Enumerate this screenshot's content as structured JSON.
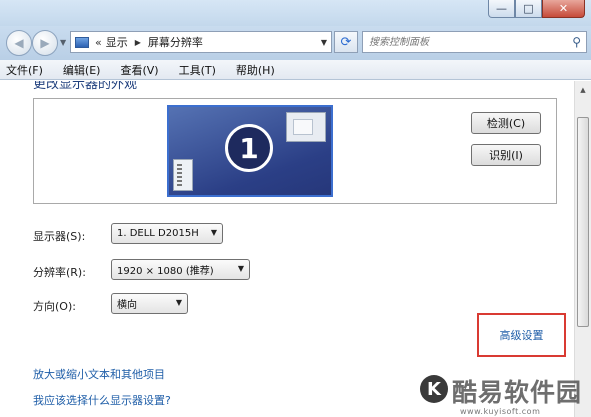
{
  "window": {
    "controls": {
      "minimize": "—",
      "maximize": "□",
      "close": "✕"
    }
  },
  "nav": {
    "back_icon": "back-arrow-icon",
    "forward_icon": "forward-arrow-icon",
    "address": {
      "chevron": "«",
      "breadcrumbs": [
        "显示",
        "屏幕分辨率"
      ]
    },
    "refresh_icon": "refresh-icon",
    "search": {
      "placeholder": "搜索控制面板",
      "icon": "search-icon"
    }
  },
  "menu": {
    "items": [
      "文件(F)",
      "编辑(E)",
      "查看(V)",
      "工具(T)",
      "帮助(H)"
    ]
  },
  "main": {
    "heading_cut": "更改显示器的外观",
    "preview": {
      "monitor_number": "1",
      "detect_button": "检测(C)",
      "identify_button": "识别(I)"
    },
    "display": {
      "label": "显示器(S):",
      "value": "1. DELL D2015H"
    },
    "resolution": {
      "label": "分辨率(R):",
      "value": "1920 × 1080 (推荐)"
    },
    "orientation": {
      "label": "方向(O):",
      "value": "横向"
    },
    "advanced_link": "高级设置",
    "links": [
      "放大或缩小文本和其他项目",
      "我应该选择什么显示器设置?"
    ]
  },
  "watermark": {
    "logo_letter": "K",
    "title": "酷易软件园",
    "url": "www.kuyisoft.com"
  },
  "colors": {
    "link": "#1f5ea8",
    "highlight_box": "#d93a32",
    "monitor_fill": "#2b3f86"
  }
}
